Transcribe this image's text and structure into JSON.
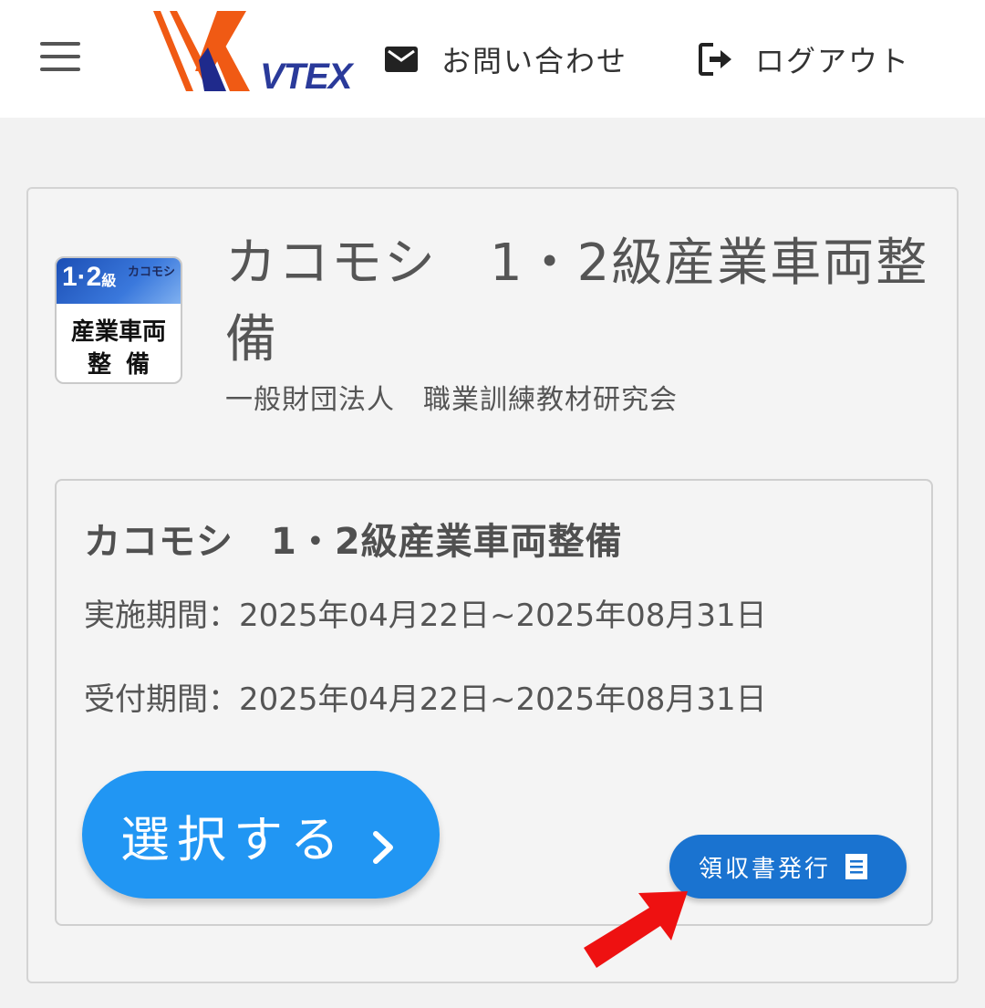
{
  "header": {
    "logo_text": "VTEX",
    "contact_label": "お問い合わせ",
    "logout_label": "ログアウト"
  },
  "course": {
    "thumb": {
      "grade": "1·2",
      "grade_suffix": "級",
      "brand": "カコモシ",
      "line1": "産業車両",
      "line2": "整備"
    },
    "title": "カコモシ　1・2級産業車両整備",
    "organization": "一般財団法人　職業訓練教材研究会",
    "detail": {
      "title": "カコモシ　1・2級産業車両整備",
      "implementation_period": "実施期間：2025年04月22日~2025年08月31日",
      "reception_period": "受付期間：2025年04月22日~2025年08月31日",
      "select_label": "選択する",
      "receipt_label": "領収書発行"
    }
  },
  "colors": {
    "primary_button": "#2196f3",
    "receipt_button": "#1a73d0",
    "annotation_arrow": "#ee1111",
    "logo_orange": "#f05a14",
    "logo_navy": "#1f2a8c"
  },
  "icons": {
    "menu": "hamburger-icon",
    "contact": "mail-icon",
    "logout": "logout-icon",
    "select": "chevron-right-icon",
    "receipt": "receipt-icon"
  }
}
